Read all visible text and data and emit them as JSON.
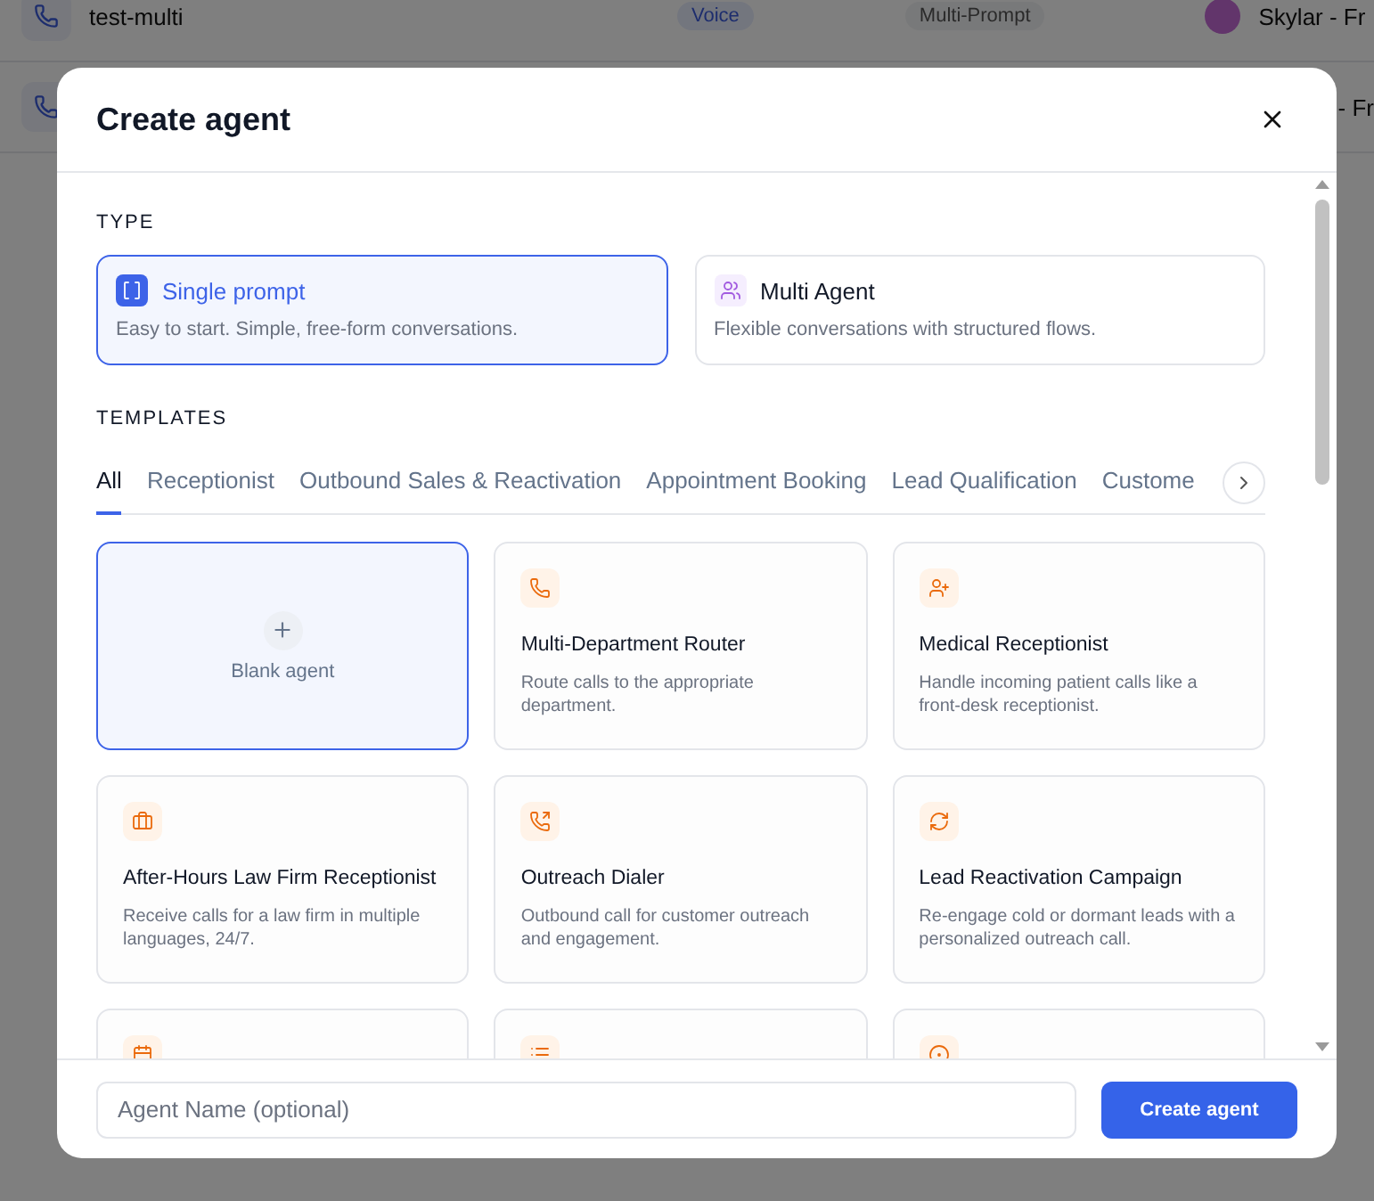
{
  "background_rows": [
    {
      "name": "test-multi",
      "channel": "Voice",
      "type": "Multi-Prompt",
      "voice": "Skylar - Fr"
    },
    {
      "voice": "- Fr"
    }
  ],
  "dialog": {
    "title": "Create agent",
    "type_label": "TYPE",
    "types": [
      {
        "kind": "single",
        "name": "Single prompt",
        "description": "Easy to start. Simple, free-form conversations.",
        "selected": true
      },
      {
        "kind": "multi",
        "name": "Multi Agent",
        "description": "Flexible conversations with structured flows.",
        "selected": false
      }
    ],
    "templates_label": "TEMPLATES",
    "tabs": [
      {
        "label": "All",
        "selected": true
      },
      {
        "label": "Receptionist",
        "selected": false
      },
      {
        "label": "Outbound Sales & Reactivation",
        "selected": false
      },
      {
        "label": "Appointment Booking",
        "selected": false
      },
      {
        "label": "Lead Qualification",
        "selected": false
      },
      {
        "label": "Custome",
        "selected": false
      }
    ],
    "blank_card": {
      "label": "Blank agent",
      "selected": true
    },
    "templates": [
      {
        "kind": "router",
        "name": "Multi-Department Router",
        "description": "Route calls to the appropriate department."
      },
      {
        "kind": "receptionist",
        "name": "Medical Receptionist",
        "description": "Handle incoming patient calls like a front-desk receptionist."
      },
      {
        "kind": "afterhours",
        "name": "After-Hours Law Firm Receptionist",
        "description": "Receive calls for a law firm in multiple languages, 24/7."
      },
      {
        "kind": "outbound",
        "name": "Outreach Dialer",
        "description": "Outbound call for customer outreach and engagement."
      },
      {
        "kind": "reactivation",
        "name": "Lead Reactivation Campaign",
        "description": "Re-engage cold or dormant leads with a personalized outreach call."
      },
      {
        "kind": "booking"
      },
      {
        "kind": "qualification"
      },
      {
        "kind": "support"
      }
    ],
    "name_field": {
      "placeholder": "Agent Name (optional)"
    },
    "create_button": "Create agent"
  }
}
